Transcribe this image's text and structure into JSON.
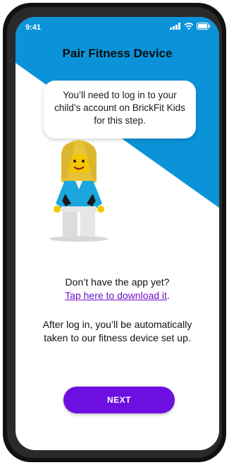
{
  "status_bar": {
    "time": "9:41",
    "icons": [
      "signal-icon",
      "wifi-icon",
      "battery-icon"
    ]
  },
  "header": {
    "title": "Pair Fitness Device"
  },
  "bubble": {
    "text": "You’ll need to log in to your child’s account on BrickFit Kids for this step."
  },
  "info": {
    "question": "Don’t have the app yet?",
    "link_label": "Tap here to download it",
    "link_suffix": ".",
    "after_login": "After log in, you’ll be automatically taken to our fitness device set up."
  },
  "actions": {
    "next_label": "NEXT"
  },
  "colors": {
    "accent_blue": "#0b93d9",
    "primary_purple": "#6d0fe0",
    "link_purple": "#6c10c9"
  }
}
